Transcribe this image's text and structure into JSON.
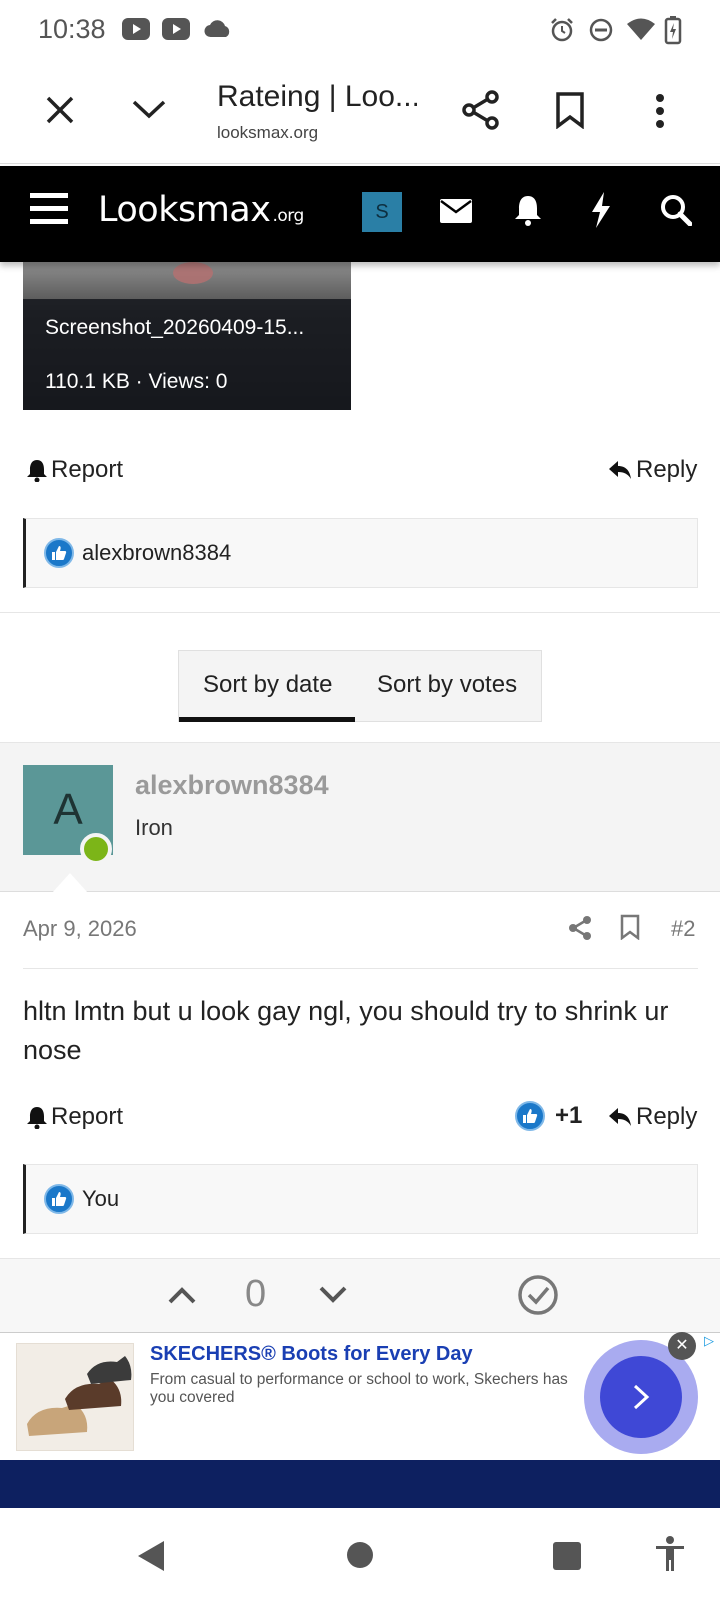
{
  "status_bar": {
    "time": "10:38",
    "left_icons": [
      "youtube-icon",
      "youtube-icon",
      "cloud-icon"
    ],
    "right_icons": [
      "alarm-icon",
      "do-not-disturb-icon",
      "wifi-icon",
      "battery-icon"
    ]
  },
  "browser": {
    "title": "Rateing | Loo...",
    "url": "looksmax.org",
    "icons": [
      "close-icon",
      "chevron-down-icon",
      "share-icon",
      "bookmark-icon",
      "more-icon"
    ]
  },
  "site_nav": {
    "logo": "Looksmax",
    "logo_suffix": ".org",
    "user_initial": "S",
    "icons": [
      "menu-icon",
      "mail-icon",
      "bell-icon",
      "bolt-icon",
      "search-icon"
    ]
  },
  "attachment": {
    "filename": "Screenshot_20260409-15...",
    "meta": "110.1 KB · Views: 0"
  },
  "post1": {
    "report": "Report",
    "reply": "Reply",
    "reaction_user": "alexbrown8384"
  },
  "sort": {
    "by_date": "Sort by date",
    "by_votes": "Sort by votes"
  },
  "post2": {
    "avatar_letter": "A",
    "username": "alexbrown8384",
    "rank": "Iron",
    "date": "Apr 9, 2026",
    "number": "#2",
    "body": "hltn lmtn but u look gay ngl, you should try to shrink ur nose",
    "report": "Report",
    "reaction_count": "+1",
    "reply": "Reply",
    "reaction_user": "You"
  },
  "votes": {
    "score": "0"
  },
  "ad": {
    "headline": "SKECHERS® Boots for Every Day",
    "description": "From casual to performance or school to work, Skechers has you covered"
  },
  "colors": {
    "brand_blue": "#2a7fa6",
    "like_blue": "#1b78c9",
    "online_green": "#7cb518",
    "ad_headline": "#1a3fb3"
  }
}
